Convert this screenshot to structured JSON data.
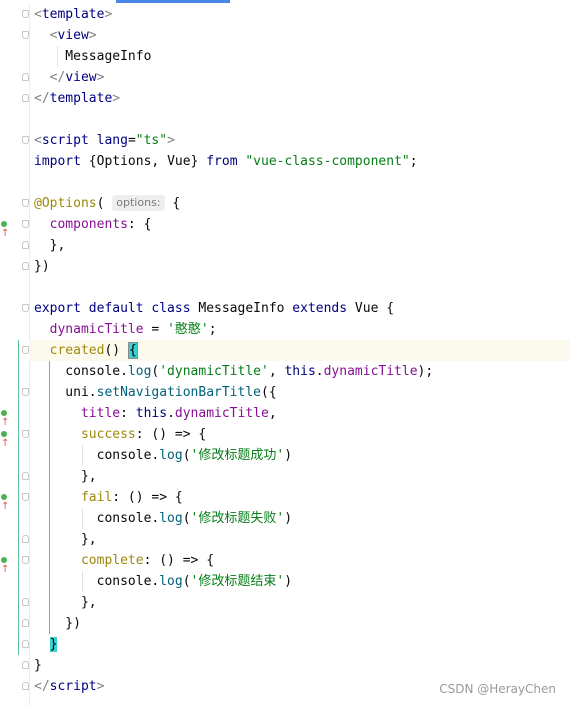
{
  "lines": [
    [
      {
        "t": "<",
        "c": "bracket"
      },
      {
        "t": "template",
        "c": "tag"
      },
      {
        "t": ">",
        "c": "bracket"
      }
    ],
    [
      {
        "t": "  <",
        "c": "bracket"
      },
      {
        "t": "view",
        "c": "tag"
      },
      {
        "t": ">",
        "c": "bracket"
      }
    ],
    [
      {
        "t": "    MessageInfo",
        "c": "plain"
      }
    ],
    [
      {
        "t": "  </",
        "c": "bracket"
      },
      {
        "t": "view",
        "c": "tag"
      },
      {
        "t": ">",
        "c": "bracket"
      }
    ],
    [
      {
        "t": "</",
        "c": "bracket"
      },
      {
        "t": "template",
        "c": "tag"
      },
      {
        "t": ">",
        "c": "bracket"
      }
    ],
    [],
    [
      {
        "t": "<",
        "c": "bracket"
      },
      {
        "t": "script ",
        "c": "tag"
      },
      {
        "t": "lang",
        "c": "tag"
      },
      {
        "t": "=",
        "c": "plain"
      },
      {
        "t": "\"ts\"",
        "c": "str"
      },
      {
        "t": ">",
        "c": "bracket"
      }
    ],
    [
      {
        "t": "import ",
        "c": "kw"
      },
      {
        "t": "{",
        "c": "plain"
      },
      {
        "t": "Options",
        "c": "plain"
      },
      {
        "t": ", Vue} ",
        "c": "plain"
      },
      {
        "t": "from ",
        "c": "kw"
      },
      {
        "t": "\"vue-class-component\"",
        "c": "str"
      },
      {
        "t": ";",
        "c": "plain"
      }
    ],
    [],
    [
      {
        "t": "@Options",
        "c": "ann"
      },
      {
        "t": "( ",
        "c": "plain"
      },
      {
        "t": "options:",
        "c": "hint"
      },
      {
        "t": " {",
        "c": "plain"
      }
    ],
    [
      {
        "t": "  components",
        "c": "prop"
      },
      {
        "t": ": {",
        "c": "plain"
      }
    ],
    [
      {
        "t": "  },",
        "c": "plain"
      }
    ],
    [
      {
        "t": "})",
        "c": "plain"
      }
    ],
    [],
    [
      {
        "t": "export default class ",
        "c": "kw"
      },
      {
        "t": "MessageInfo ",
        "c": "plain"
      },
      {
        "t": "extends ",
        "c": "kw"
      },
      {
        "t": "Vue ",
        "c": "plain"
      },
      {
        "t": "{",
        "c": "plain"
      }
    ],
    [
      {
        "t": "  dynamicTitle",
        "c": "prop"
      },
      {
        "t": " = ",
        "c": "plain"
      },
      {
        "t": "'憨憨'",
        "c": "str"
      },
      {
        "t": ";",
        "c": "plain"
      }
    ],
    [
      {
        "t": "  created",
        "c": "ann"
      },
      {
        "t": "() ",
        "c": "plain"
      },
      {
        "t": "{",
        "c": "brace-hl brace-box"
      }
    ],
    [
      {
        "t": "    console.",
        "c": "plain"
      },
      {
        "t": "log",
        "c": "fn"
      },
      {
        "t": "(",
        "c": "plain"
      },
      {
        "t": "'dynamicTitle'",
        "c": "str"
      },
      {
        "t": ", ",
        "c": "plain"
      },
      {
        "t": "this",
        "c": "kw"
      },
      {
        "t": ".",
        "c": "plain"
      },
      {
        "t": "dynamicTitle",
        "c": "prop"
      },
      {
        "t": ");",
        "c": "plain"
      }
    ],
    [
      {
        "t": "    uni.",
        "c": "plain"
      },
      {
        "t": "setNavigationBarTitle",
        "c": "fn"
      },
      {
        "t": "({",
        "c": "plain"
      }
    ],
    [
      {
        "t": "      title",
        "c": "prop"
      },
      {
        "t": ": ",
        "c": "plain"
      },
      {
        "t": "this",
        "c": "kw"
      },
      {
        "t": ".",
        "c": "plain"
      },
      {
        "t": "dynamicTitle",
        "c": "prop"
      },
      {
        "t": ",",
        "c": "plain"
      }
    ],
    [
      {
        "t": "      success",
        "c": "ann"
      },
      {
        "t": ": () => {",
        "c": "plain"
      }
    ],
    [
      {
        "t": "        console.",
        "c": "plain"
      },
      {
        "t": "log",
        "c": "fn"
      },
      {
        "t": "(",
        "c": "plain"
      },
      {
        "t": "'修改标题成功'",
        "c": "str"
      },
      {
        "t": ")",
        "c": "plain"
      }
    ],
    [
      {
        "t": "      },",
        "c": "plain"
      }
    ],
    [
      {
        "t": "      fail",
        "c": "ann"
      },
      {
        "t": ": () => {",
        "c": "plain"
      }
    ],
    [
      {
        "t": "        console.",
        "c": "plain"
      },
      {
        "t": "log",
        "c": "fn"
      },
      {
        "t": "(",
        "c": "plain"
      },
      {
        "t": "'修改标题失败'",
        "c": "str"
      },
      {
        "t": ")",
        "c": "plain"
      }
    ],
    [
      {
        "t": "      },",
        "c": "plain"
      }
    ],
    [
      {
        "t": "      complete",
        "c": "ann"
      },
      {
        "t": ": () => {",
        "c": "plain"
      }
    ],
    [
      {
        "t": "        console.",
        "c": "plain"
      },
      {
        "t": "log",
        "c": "fn"
      },
      {
        "t": "(",
        "c": "plain"
      },
      {
        "t": "'修改标题结束'",
        "c": "str"
      },
      {
        "t": ")",
        "c": "plain"
      }
    ],
    [
      {
        "t": "      },",
        "c": "plain"
      }
    ],
    [
      {
        "t": "    })",
        "c": "plain"
      }
    ],
    [
      {
        "t": "  ",
        "c": "plain"
      },
      {
        "t": "}",
        "c": "brace-hl"
      }
    ],
    [
      {
        "t": "}",
        "c": "plain"
      }
    ],
    [
      {
        "t": "</",
        "c": "bracket"
      },
      {
        "t": "script",
        "c": "tag"
      },
      {
        "t": ">",
        "c": "bracket"
      }
    ]
  ],
  "watermark": "CSDN @HerayChen"
}
